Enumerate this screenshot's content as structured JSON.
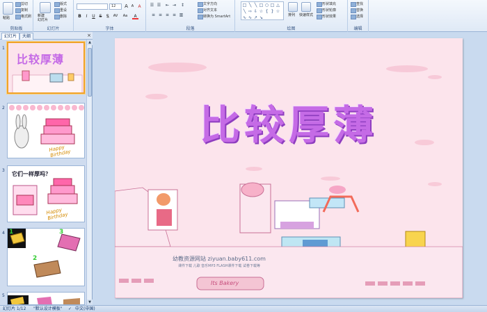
{
  "ribbon": {
    "clipboard": {
      "paste": "粘贴",
      "cut": "剪切",
      "copy": "复制",
      "format_painter": "格式刷",
      "group": "剪贴板"
    },
    "slides": {
      "new_slide": "新建\n幻灯片",
      "layout": "版式",
      "reset": "重设",
      "delete": "删除",
      "group": "幻灯片"
    },
    "font": {
      "font_name": "",
      "font_size": "12",
      "grow": "A",
      "shrink": "A",
      "clear": "A",
      "bold": "B",
      "italic": "I",
      "underline": "U",
      "strike": "S",
      "shadow": "S",
      "spacing": "AV",
      "case": "Aa",
      "color": "A",
      "group": "字体"
    },
    "paragraph": {
      "text_direction": "文字方向",
      "align_text": "对齐文本",
      "smartart": "转换为 SmartArt",
      "group": "段落"
    },
    "drawing": {
      "arrange": "排列",
      "quick_styles": "快速样式",
      "fill": "形状填充",
      "outline": "形状轮廓",
      "effects": "形状效果",
      "group": "绘图"
    },
    "editing": {
      "find": "查找",
      "replace": "替换",
      "select": "选择",
      "group": "编辑"
    }
  },
  "pane": {
    "tabs": [
      "幻灯片",
      "大纲"
    ],
    "close": "×",
    "thumbs": [
      {
        "num": "1",
        "title": "比较厚薄"
      },
      {
        "num": "2",
        "banner": "Happy Birthday"
      },
      {
        "num": "3",
        "question": "它们一样厚吗？",
        "banner": "Happy Birthday"
      },
      {
        "num": "4",
        "labels": [
          "1",
          "3",
          "2"
        ]
      },
      {
        "num": "5"
      }
    ]
  },
  "slide": {
    "title": "比较厚薄",
    "watermark": "幼教资源网站  ziyuan.baby611.com",
    "watermark_sub": "课件下载  儿歌  音乐MP3  FLASH课件下载  试卷下载等",
    "shop_sign": "Its Bakery"
  },
  "status": {
    "slide_count": "幻灯片 1/12",
    "theme": "\"默认设计模板\"",
    "language": "中文(中国)"
  },
  "colors": {
    "title": "#c56be6",
    "slide_bg": "#fce4ec",
    "selected_border": "#f0a32a"
  }
}
